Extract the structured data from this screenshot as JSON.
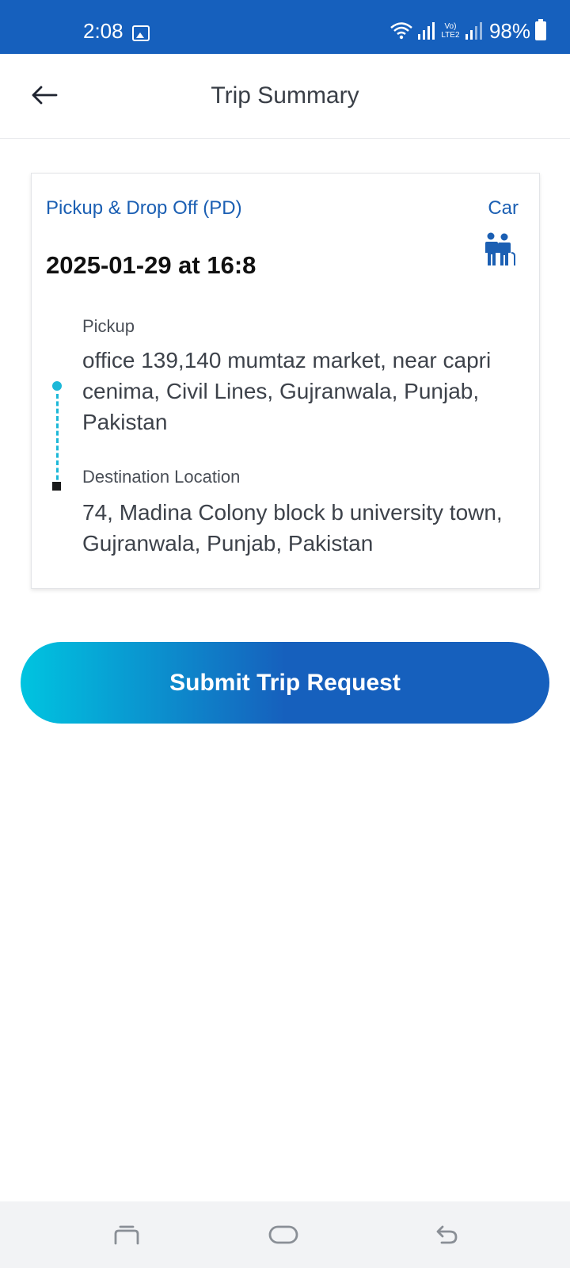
{
  "status_bar": {
    "time": "2:08",
    "battery": "98%",
    "network": "Vo) LTE2",
    "icons": [
      "gallery-icon",
      "wifi-icon",
      "signal-icon",
      "volte-icon",
      "battery-icon"
    ]
  },
  "header": {
    "title": "Trip Summary",
    "back_icon": "arrow-left-icon"
  },
  "trip": {
    "type": "Pickup & Drop Off (PD)",
    "vehicle": "Car",
    "vehicle_icon": "people-icon",
    "datetime": "2025-01-29 at 16:8",
    "pickup_label": "Pickup",
    "pickup_address": "office 139,140 mumtaz market, near capri cenima, Civil Lines, Gujranwala, Punjab, Pakistan",
    "destination_label": "Destination Location",
    "destination_address": "74, Madina Colony block b university town, Gujranwala, Punjab, Pakistan"
  },
  "actions": {
    "submit_label": "Submit Trip Request"
  },
  "colors": {
    "brand_blue": "#1660bd",
    "accent_cyan": "#00c4e0",
    "route_dot": "#1cb8d8"
  },
  "nav_bar": {
    "icons": [
      "recents-icon",
      "home-icon",
      "back-icon"
    ]
  }
}
